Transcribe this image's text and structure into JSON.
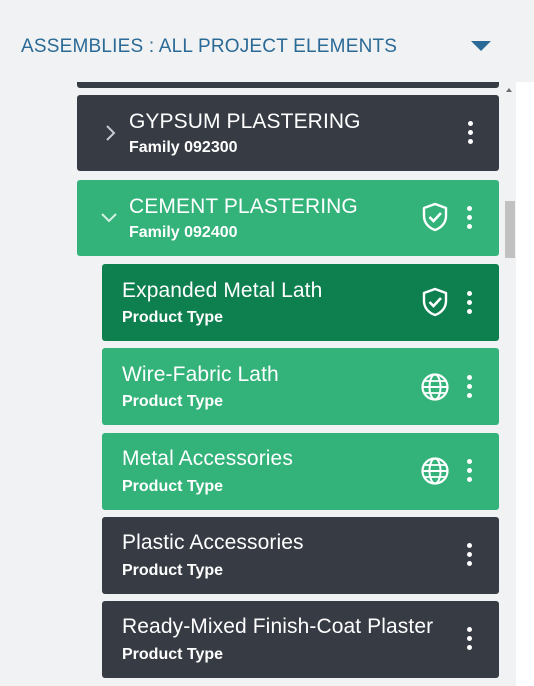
{
  "header": {
    "title_prefix": "ASSEMBLIES :",
    "title_value": "ALL PROJECT ELEMENTS",
    "dropdown_icon": "caret-down-icon"
  },
  "items": [
    {
      "title": "GYPSUM PLASTERING",
      "subtitle": "Family 092300",
      "expand_icon": "chevron-right-icon",
      "status_icon": null,
      "menu_icon": "more-vertical-icon",
      "state": "collapsed"
    },
    {
      "title": "CEMENT PLASTERING",
      "subtitle": "Family 092400",
      "expand_icon": "chevron-down-icon",
      "status_icon": "shield-check-icon",
      "menu_icon": "more-vertical-icon",
      "state": "expanded"
    },
    {
      "title": "Expanded Metal Lath",
      "subtitle": "Product Type",
      "status_icon": "shield-check-icon",
      "menu_icon": "more-vertical-icon",
      "state": "selected"
    },
    {
      "title": "Wire-Fabric Lath",
      "subtitle": "Product Type",
      "status_icon": "globe-icon",
      "menu_icon": "more-vertical-icon",
      "state": "included"
    },
    {
      "title": "Metal Accessories",
      "subtitle": "Product Type",
      "status_icon": "globe-icon",
      "menu_icon": "more-vertical-icon",
      "state": "included"
    },
    {
      "title": "Plastic Accessories",
      "subtitle": "Product Type",
      "status_icon": null,
      "menu_icon": "more-vertical-icon",
      "state": "default"
    },
    {
      "title": "Ready-Mixed Finish-Coat Plaster",
      "subtitle": "Product Type",
      "status_icon": null,
      "menu_icon": "more-vertical-icon",
      "state": "default"
    }
  ],
  "colors": {
    "header_text": "#2b6a96",
    "dark_card": "#363b44",
    "green_card": "#33b37a",
    "selected_card": "#0e7f4e",
    "background": "#f1f2f3"
  }
}
